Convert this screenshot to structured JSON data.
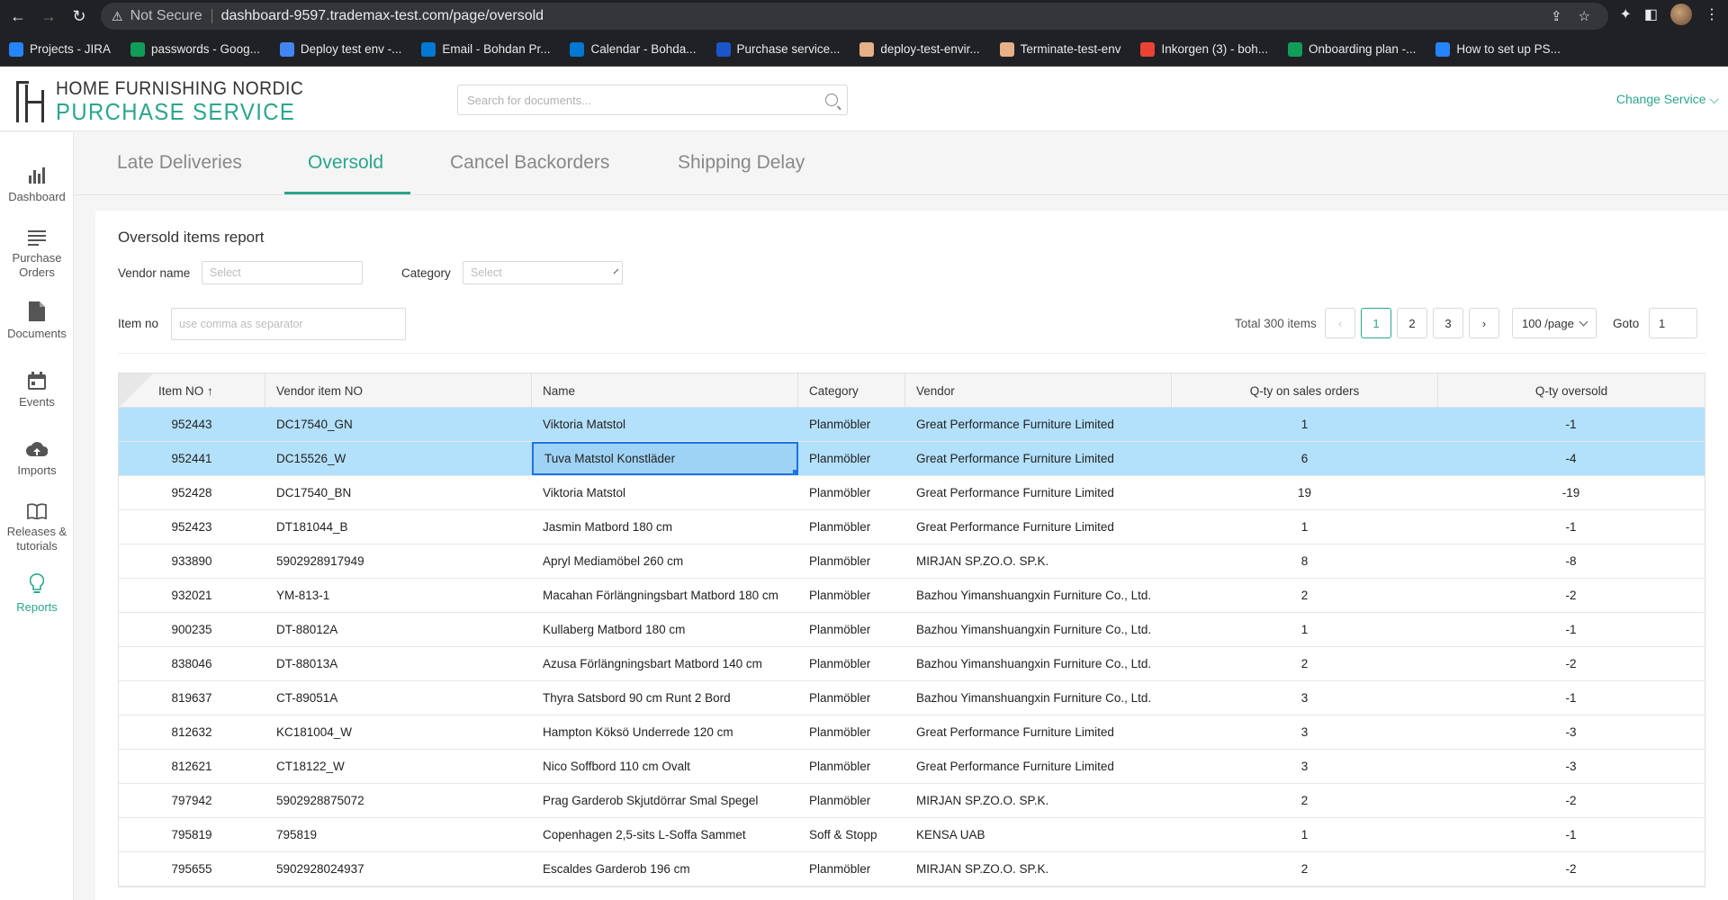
{
  "browser": {
    "security_icon": "⚠",
    "not_secure": "Not Secure",
    "url": "dashboard-9597.trademax-test.com/page/oversold",
    "bookmarks": [
      {
        "label": "Projects - JIRA",
        "color": "#2684ff"
      },
      {
        "label": "passwords - Goog...",
        "color": "#0f9d58"
      },
      {
        "label": "Deploy test env -...",
        "color": "#4285f4"
      },
      {
        "label": "Email - Bohdan Pr...",
        "color": "#0078d4"
      },
      {
        "label": "Calendar - Bohda...",
        "color": "#0078d4"
      },
      {
        "label": "Purchase service...",
        "color": "#1a55c9"
      },
      {
        "label": "deploy-test-envir...",
        "color": "#e8b087"
      },
      {
        "label": "Terminate-test-env",
        "color": "#e8b087"
      },
      {
        "label": "Inkorgen (3) - boh...",
        "color": "#ea4335"
      },
      {
        "label": "Onboarding plan -...",
        "color": "#0f9d58"
      },
      {
        "label": "How to set up PS...",
        "color": "#2684ff"
      }
    ]
  },
  "header": {
    "logo_line1": "HOME FURNISHING NORDIC",
    "logo_line2": "PURCHASE SERVICE",
    "search_placeholder": "Search for documents...",
    "change_service": "Change Service ⌵"
  },
  "sidebar": {
    "items": [
      {
        "label": "Dashboard",
        "icon": "bar-chart-icon"
      },
      {
        "label": "Purchase Orders",
        "icon": "list-icon"
      },
      {
        "label": "Documents",
        "icon": "document-icon"
      },
      {
        "label": "Events",
        "icon": "calendar-icon"
      },
      {
        "label": "Imports",
        "icon": "cloud-upload-icon"
      },
      {
        "label": "Releases & tutorials",
        "icon": "book-icon"
      },
      {
        "label": "Reports",
        "icon": "bulb-icon"
      }
    ]
  },
  "tabs": [
    "Late Deliveries",
    "Oversold",
    "Cancel Backorders",
    "Shipping Delay"
  ],
  "report": {
    "title": "Oversold items report",
    "vendor_label": "Vendor name",
    "vendor_placeholder": "Select",
    "category_label": "Category",
    "category_placeholder": "Select",
    "itemno_label": "Item no",
    "itemno_placeholder": "use comma as separator",
    "total": "Total 300 items",
    "pages": [
      "1",
      "2",
      "3"
    ],
    "prev": "‹",
    "next": "›",
    "page_size": "100 /page",
    "goto_label": "Goto",
    "goto_value": "1"
  },
  "table": {
    "headers": [
      "Item NO  ↑",
      "Vendor item NO",
      "Name",
      "Category",
      "Vendor",
      "Q-ty on sales orders",
      "Q-ty oversold"
    ],
    "rows": [
      [
        "952443",
        "DC17540_GN",
        "Viktoria Matstol",
        "Planmöbler",
        "Great Performance Furniture Limited",
        "1",
        "-1"
      ],
      [
        "952441",
        "DC15526_W",
        "Tuva Matstol Konstläder",
        "Planmöbler",
        "Great Performance Furniture Limited",
        "6",
        "-4"
      ],
      [
        "952428",
        "DC17540_BN",
        "Viktoria Matstol",
        "Planmöbler",
        "Great Performance Furniture Limited",
        "19",
        "-19"
      ],
      [
        "952423",
        "DT181044_B",
        "Jasmin Matbord 180 cm",
        "Planmöbler",
        "Great Performance Furniture Limited",
        "1",
        "-1"
      ],
      [
        "933890",
        "5902928917949",
        "Apryl Mediamöbel 260 cm",
        "Planmöbler",
        "MIRJAN SP.ZO.O. SP.K.",
        "8",
        "-8"
      ],
      [
        "932021",
        "YM-813-1",
        "Macahan Förlängningsbart Matbord 180 cm",
        "Planmöbler",
        "Bazhou Yimanshuangxin Furniture Co., Ltd.",
        "2",
        "-2"
      ],
      [
        "900235",
        "DT-88012A",
        "Kullaberg Matbord 180 cm",
        "Planmöbler",
        "Bazhou Yimanshuangxin Furniture Co., Ltd.",
        "1",
        "-1"
      ],
      [
        "838046",
        "DT-88013A",
        "Azusa Förlängningsbart Matbord 140 cm",
        "Planmöbler",
        "Bazhou Yimanshuangxin Furniture Co., Ltd.",
        "2",
        "-2"
      ],
      [
        "819637",
        "CT-89051A",
        "Thyra Satsbord 90 cm Runt 2 Bord",
        "Planmöbler",
        "Bazhou Yimanshuangxin Furniture Co., Ltd.",
        "3",
        "-1"
      ],
      [
        "812632",
        "KC181004_W",
        "Hampton Köksö Underrede 120 cm",
        "Planmöbler",
        "Great Performance Furniture Limited",
        "3",
        "-3"
      ],
      [
        "812621",
        "CT18122_W",
        "Nico Soffbord 110 cm Ovalt",
        "Planmöbler",
        "Great Performance Furniture Limited",
        "3",
        "-3"
      ],
      [
        "797942",
        "5902928875072",
        "Prag Garderob Skjutdörrar Smal Spegel",
        "Planmöbler",
        "MIRJAN SP.ZO.O. SP.K.",
        "2",
        "-2"
      ],
      [
        "795819",
        "795819",
        "Copenhagen 2,5-sits L-Soffa Sammet",
        "Soff & Stopp",
        "KENSA UAB",
        "1",
        "-1"
      ],
      [
        "795655",
        "5902928024937",
        "Escaldes Garderob 196 cm",
        "Planmöbler",
        "MIRJAN SP.ZO.O. SP.K.",
        "2",
        "-2"
      ]
    ]
  }
}
